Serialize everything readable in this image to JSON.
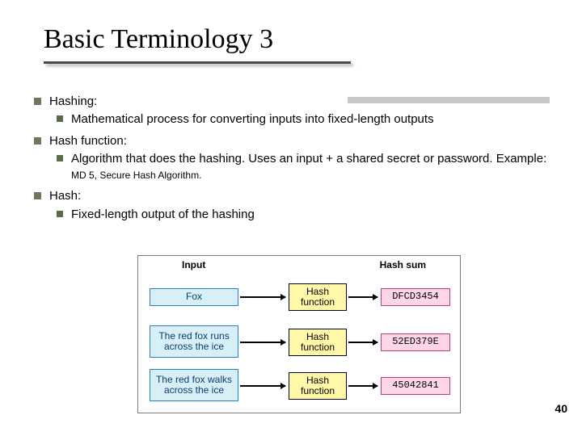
{
  "title": "Basic Terminology 3",
  "bullets": {
    "hashing_label": "Hashing:",
    "hashing_def": "Mathematical process for converting inputs into fixed-length outputs",
    "hashfunc_label": "Hash function:",
    "hashfunc_def_main": "Algorithm that does the hashing. Uses an input + a shared secret or password. Example: ",
    "hashfunc_def_small": "MD 5, Secure Hash Algorithm.",
    "hash_label": "Hash:",
    "hash_def": "Fixed-length output of the hashing"
  },
  "diagram": {
    "heading_input": "Input",
    "heading_output": "Hash sum",
    "func_label": "Hash function",
    "rows": [
      {
        "input": "Fox",
        "output": "DFCD3454"
      },
      {
        "input": "The red fox runs across the ice",
        "output": "52ED379E"
      },
      {
        "input": "The red fox walks across the ice",
        "output": "45042841"
      }
    ]
  },
  "page_number": "40"
}
